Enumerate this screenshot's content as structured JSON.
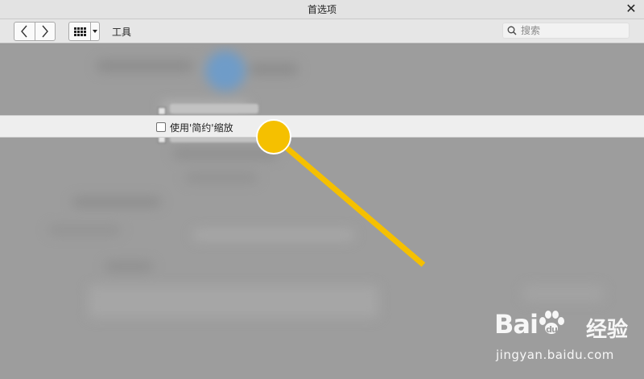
{
  "window": {
    "title": "首选项"
  },
  "toolbar": {
    "back_icon": "chevron-left-icon",
    "forward_icon": "chevron-right-icon",
    "grid_icon": "grid-icon",
    "dropdown_icon": "caret-down-icon",
    "category_label": "工具",
    "search_placeholder": "搜索"
  },
  "option": {
    "label": "使用'简约'缩放",
    "checked": false
  },
  "pointer": {
    "color": "#F5C000",
    "icon": "annotation-pointer-icon"
  },
  "watermark": {
    "brand": "Bai",
    "brand_suffix": "du",
    "sub": "经验",
    "url": "jingyan.baidu.com"
  }
}
